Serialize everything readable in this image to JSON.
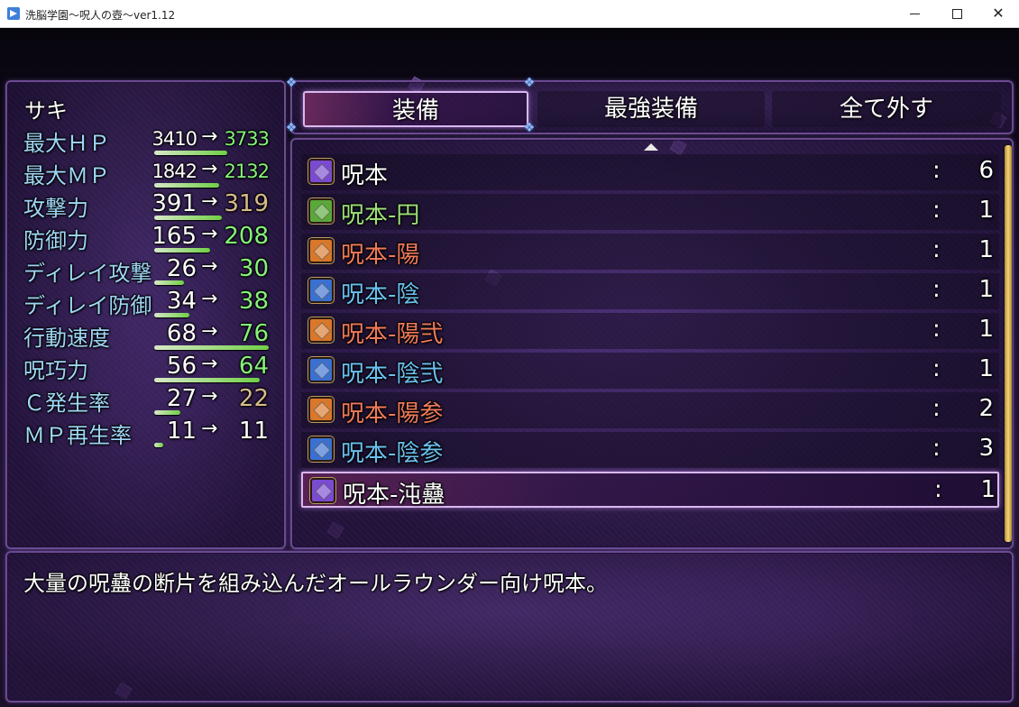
{
  "window": {
    "title": "洗脳学園～呪人の壺～ver1.12",
    "minimize_icon": "minimize-icon",
    "maximize_icon": "maximize-icon",
    "close_label": "✕"
  },
  "status": {
    "actor_name": "サキ",
    "stats": [
      {
        "label": "最大ＨＰ",
        "old": "3410",
        "arrow": "→",
        "new": "3733",
        "new_color": "#86f27a",
        "bar": 0.62,
        "small": true
      },
      {
        "label": "最大ＭＰ",
        "old": "1842",
        "arrow": "→",
        "new": "2132",
        "new_color": "#86f27a",
        "bar": 0.55,
        "small": true
      },
      {
        "label": "攻撃力",
        "old": "391",
        "arrow": "→",
        "new": "319",
        "new_color": "#d8bb8a",
        "bar": 0.58,
        "small": false
      },
      {
        "label": "防御力",
        "old": "165",
        "arrow": "→",
        "new": "208",
        "new_color": "#86f27a",
        "bar": 0.48,
        "small": false
      },
      {
        "label": "ディレイ攻撃",
        "old": "26",
        "arrow": "→",
        "new": "30",
        "new_color": "#86f27a",
        "bar": 0.25,
        "small": false
      },
      {
        "label": "ディレイ防御",
        "old": "34",
        "arrow": "→",
        "new": "38",
        "new_color": "#86f27a",
        "bar": 0.3,
        "small": false
      },
      {
        "label": "行動速度",
        "old": "68",
        "arrow": "→",
        "new": "76",
        "new_color": "#86f27a",
        "bar": 0.98,
        "small": false
      },
      {
        "label": "呪巧力",
        "old": "56",
        "arrow": "→",
        "new": "64",
        "new_color": "#86f27a",
        "bar": 0.9,
        "small": false
      },
      {
        "label": "Ｃ発生率",
        "old": "27",
        "arrow": "→",
        "new": "22",
        "new_color": "#d8bb8a",
        "bar": 0.22,
        "small": false
      },
      {
        "label": "ＭＰ再生率",
        "old": "11",
        "arrow": "→",
        "new": "11",
        "new_color": "#ffffff",
        "bar": 0.08,
        "small": false
      }
    ]
  },
  "commands": {
    "equip": "装備",
    "optimize": "最強装備",
    "clear": "全て外す"
  },
  "items": [
    {
      "name": "呪本",
      "colon": ":",
      "count": "6",
      "color": "#ffffff",
      "icon": "purple-book-icon",
      "icon_color": "#7a4ad0"
    },
    {
      "name": "呪本-円",
      "colon": ":",
      "count": "1",
      "color": "#9ee07a",
      "icon": "green-book-icon",
      "icon_color": "#5aa83a"
    },
    {
      "name": "呪本-陽",
      "colon": ":",
      "count": "1",
      "color": "#f07a5a",
      "icon": "orange-book-icon",
      "icon_color": "#d9782a"
    },
    {
      "name": "呪本-陰",
      "colon": ":",
      "count": "1",
      "color": "#6ac0f0",
      "icon": "blue-book-icon",
      "icon_color": "#3a70d0"
    },
    {
      "name": "呪本-陽弐",
      "colon": ":",
      "count": "1",
      "color": "#f07a5a",
      "icon": "orange-book-icon",
      "icon_color": "#d9782a"
    },
    {
      "name": "呪本-陰弐",
      "colon": ":",
      "count": "1",
      "color": "#6ac0f0",
      "icon": "blue-book-icon",
      "icon_color": "#3a70d0"
    },
    {
      "name": "呪本-陽参",
      "colon": ":",
      "count": "2",
      "color": "#f07a5a",
      "icon": "orange-book-icon",
      "icon_color": "#d9782a"
    },
    {
      "name": "呪本-陰参",
      "colon": ":",
      "count": "3",
      "color": "#6ac0f0",
      "icon": "blue-book-icon",
      "icon_color": "#3a70d0"
    },
    {
      "name": "呪本-沌蠱",
      "colon": ":",
      "count": "1",
      "color": "#ffffff",
      "icon": "purple-book-icon",
      "icon_color": "#7a4ad0",
      "selected": true
    }
  ],
  "help": {
    "text": "大量の呪蠱の断片を組み込んだオールラウンダー向け呪本。"
  }
}
